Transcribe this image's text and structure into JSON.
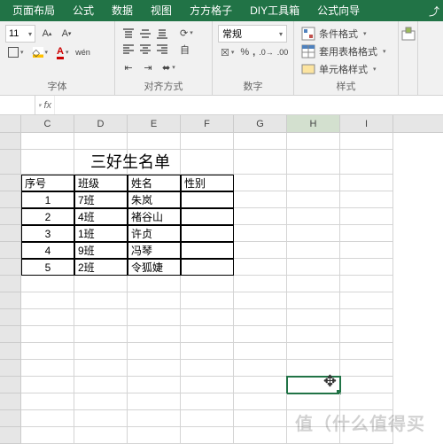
{
  "tabs": [
    "页面布局",
    "公式",
    "数据",
    "视图",
    "方方格子",
    "DIY工具箱",
    "公式向导"
  ],
  "font": {
    "size": "11",
    "group_label": "字体"
  },
  "align": {
    "group_label": "对齐方式",
    "wrap": "自"
  },
  "number": {
    "format": "常规",
    "group_label": "数字"
  },
  "styles": {
    "conditional": "条件格式",
    "table": "套用表格格式",
    "cell": "单元格样式",
    "group_label": "样式"
  },
  "formula_bar": {
    "name": "",
    "fx": "fx",
    "value": ""
  },
  "columns": [
    "C",
    "D",
    "E",
    "F",
    "G",
    "H",
    "I"
  ],
  "table": {
    "title": "三好生名单",
    "headers": [
      "序号",
      "班级",
      "姓名",
      "性别"
    ],
    "rows": [
      {
        "n": "1",
        "cls": "7班",
        "name": "朱岚",
        "sex": ""
      },
      {
        "n": "2",
        "cls": "4班",
        "name": "褚谷山",
        "sex": ""
      },
      {
        "n": "3",
        "cls": "1班",
        "name": "许贞",
        "sex": ""
      },
      {
        "n": "4",
        "cls": "9班",
        "name": "冯琴",
        "sex": ""
      },
      {
        "n": "5",
        "cls": "2班",
        "name": "令狐婕",
        "sex": ""
      }
    ]
  },
  "watermark": "值（什么值得买",
  "chart_data": {
    "type": "table",
    "title": "三好生名单",
    "columns": [
      "序号",
      "班级",
      "姓名",
      "性别"
    ],
    "rows": [
      [
        1,
        "7班",
        "朱岚",
        ""
      ],
      [
        2,
        "4班",
        "褚谷山",
        ""
      ],
      [
        3,
        "1班",
        "许贞",
        ""
      ],
      [
        4,
        "9班",
        "冯琴",
        ""
      ],
      [
        5,
        "2班",
        "令狐婕",
        ""
      ]
    ]
  }
}
